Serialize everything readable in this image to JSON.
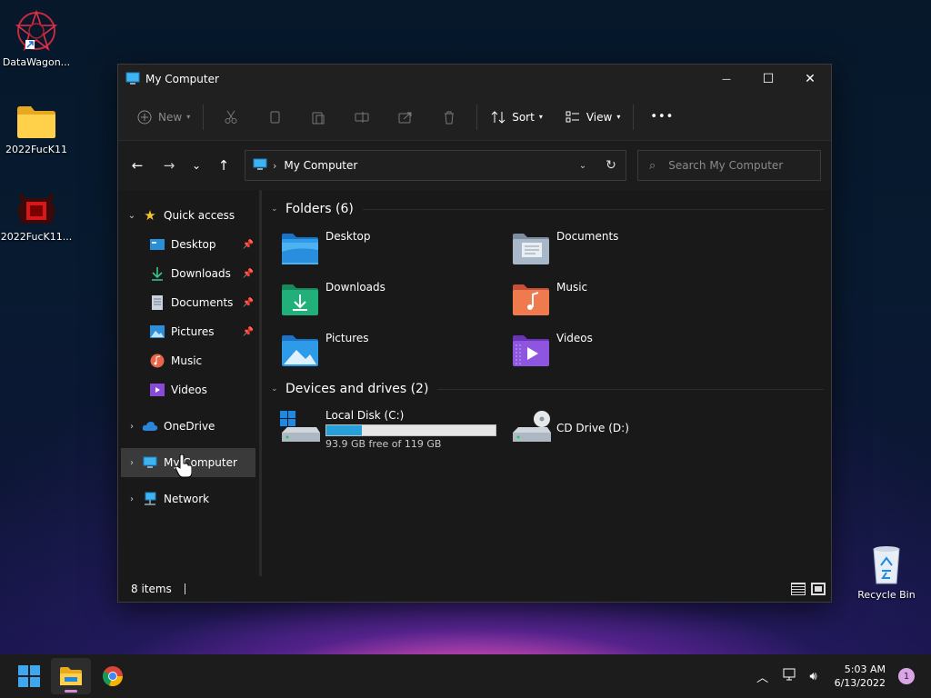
{
  "desktop": {
    "icons": [
      {
        "label": "DataWagon...",
        "icon": "star-emblem-icon"
      },
      {
        "label": "2022FucK11",
        "icon": "folder-icon"
      },
      {
        "label": "2022FucK11...",
        "icon": "red-app-icon"
      },
      {
        "label": "Recycle Bin",
        "icon": "recycle-bin-icon"
      }
    ]
  },
  "window": {
    "title": "My Computer",
    "controls": {
      "minimize": "—",
      "maximize": "☐",
      "close": "✕"
    }
  },
  "toolbar": {
    "new_label": "New",
    "sort_label": "Sort",
    "view_label": "View",
    "more_label": "•••"
  },
  "navbar": {
    "breadcrumb": "My Computer",
    "search_placeholder": "Search My Computer"
  },
  "sidebar": {
    "quick_access": "Quick access",
    "quick_items": [
      {
        "label": "Desktop",
        "pinned": true
      },
      {
        "label": "Downloads",
        "pinned": true
      },
      {
        "label": "Documents",
        "pinned": true
      },
      {
        "label": "Pictures",
        "pinned": true
      },
      {
        "label": "Music",
        "pinned": false
      },
      {
        "label": "Videos",
        "pinned": false
      }
    ],
    "onedrive": "OneDrive",
    "my_computer": "My Computer",
    "network": "Network"
  },
  "main": {
    "folders_header": "Folders (6)",
    "folders": [
      "Desktop",
      "Documents",
      "Downloads",
      "Music",
      "Pictures",
      "Videos"
    ],
    "drives_header": "Devices and drives (2)",
    "drives": [
      {
        "name": "Local Disk (C:)",
        "free_text": "93.9 GB free of 119 GB",
        "used_fraction": 0.21
      },
      {
        "name": "CD Drive (D:)"
      }
    ]
  },
  "status": {
    "items_text": "8 items"
  },
  "taskbar": {
    "time": "5:03 AM",
    "date": "6/13/2022",
    "notification_count": "1"
  },
  "colors": {
    "accent": "#26a0da",
    "window_bg": "#191919",
    "selection": "#3a3a3a"
  }
}
